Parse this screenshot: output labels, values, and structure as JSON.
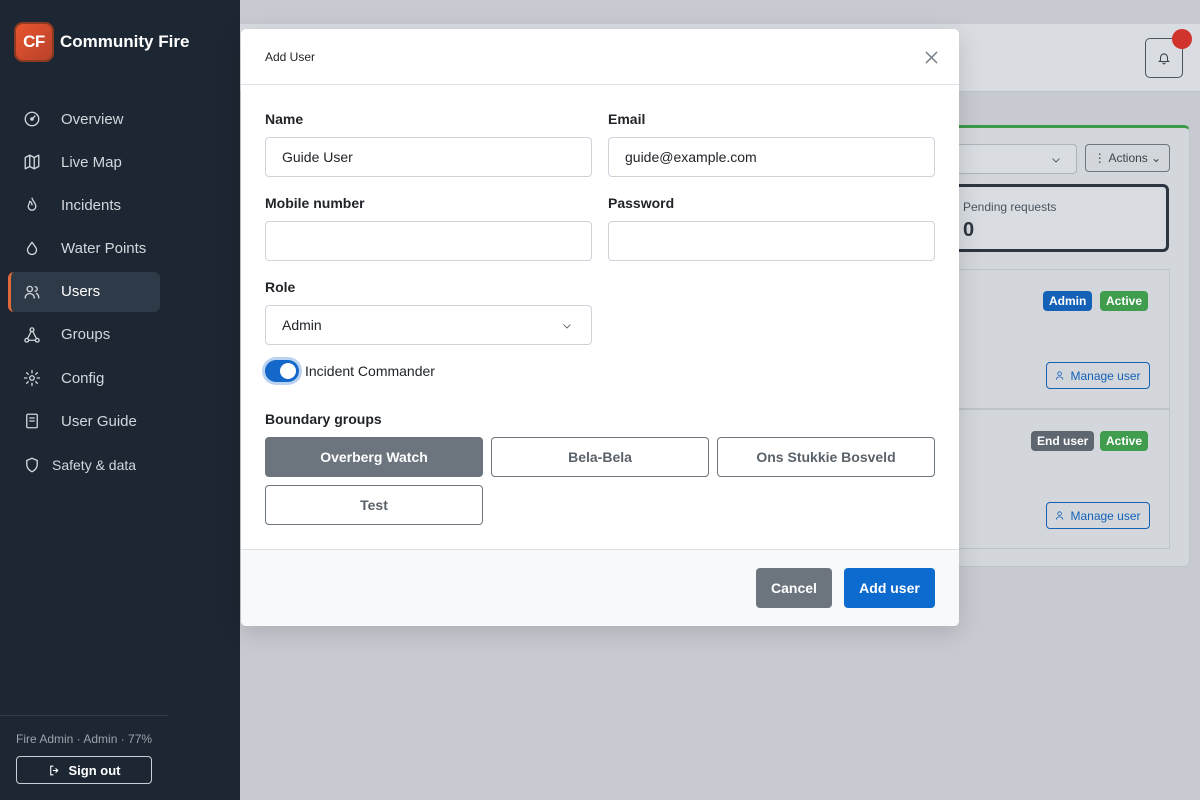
{
  "app": {
    "logo_text": "CF",
    "name": "Community Fire"
  },
  "sidebar": {
    "items": [
      {
        "label": "Overview",
        "icon": "gauge-icon"
      },
      {
        "label": "Live Map",
        "icon": "map-icon"
      },
      {
        "label": "Incidents",
        "icon": "flame-icon"
      },
      {
        "label": "Water Points",
        "icon": "droplet-icon"
      },
      {
        "label": "Users",
        "icon": "users-icon",
        "active": true
      },
      {
        "label": "Groups",
        "icon": "share-nodes-icon"
      },
      {
        "label": "Config",
        "icon": "gear-icon"
      },
      {
        "label": "User Guide",
        "icon": "book-icon"
      },
      {
        "label": "Safety & data",
        "icon": "shield-icon"
      }
    ],
    "user_meta": "Fire Admin · Admin · 77%",
    "sign_out_label": "Sign out"
  },
  "background": {
    "actions_label": "⋮ Actions ⌄",
    "pending_label": "Pending requests",
    "pending_value": "0",
    "rows": [
      {
        "badges": [
          "Admin",
          "Active"
        ],
        "manage_label": "Manage user"
      },
      {
        "badges": [
          "End user",
          "Active"
        ],
        "manage_label": "Manage user"
      }
    ]
  },
  "modal": {
    "title": "Add User",
    "name_label": "Name",
    "name_value": "Guide User",
    "email_label": "Email",
    "email_value": "guide@example.com",
    "mobile_label": "Mobile number",
    "mobile_value": "",
    "password_label": "Password",
    "password_value": "",
    "role_label": "Role",
    "role_value": "Admin",
    "commander_label": "Incident Commander",
    "commander_on": true,
    "groups_label": "Boundary groups",
    "groups": [
      {
        "label": "Overberg Watch",
        "selected": true
      },
      {
        "label": "Bela-Bela",
        "selected": false
      },
      {
        "label": "Ons Stukkie Bosveld",
        "selected": false
      },
      {
        "label": "Test",
        "selected": false
      }
    ],
    "cancel_label": "Cancel",
    "submit_label": "Add user"
  },
  "colors": {
    "sidebar_bg": "#1c2733",
    "accent": "#e06a3c",
    "primary": "#0d6bd0",
    "secondary": "#6c757d",
    "success": "#3f9d4d",
    "danger": "#d0342c"
  }
}
